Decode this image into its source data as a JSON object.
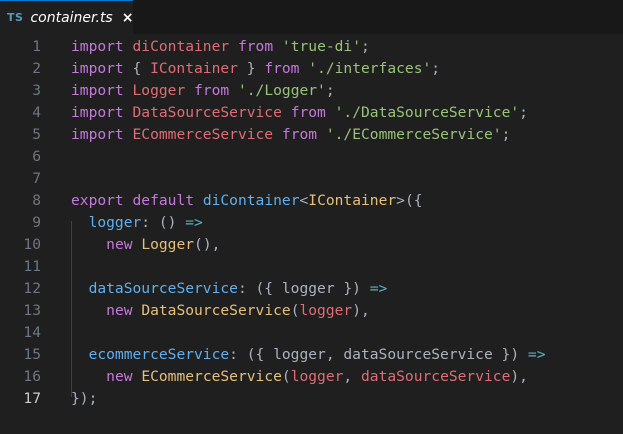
{
  "tab": {
    "lang_badge": "TS",
    "filename": "container.ts",
    "close_glyph": "×",
    "close_icon": "close-icon"
  },
  "colors": {
    "keyword": "#c678dd",
    "identifier": "#e06c75",
    "function": "#61afef",
    "type": "#e5c07b",
    "string": "#98c379",
    "punctuation": "#abb2bf",
    "operator": "#56b6c2"
  },
  "editor": {
    "active_line": "17",
    "lines": [
      {
        "number": "1",
        "tokens": [
          [
            "k",
            "import"
          ],
          [
            "p",
            " "
          ],
          [
            "d",
            "diContainer"
          ],
          [
            "p",
            " "
          ],
          [
            "k",
            "from"
          ],
          [
            "p",
            " "
          ],
          [
            "s",
            "'true-di'"
          ],
          [
            "p",
            ";"
          ]
        ]
      },
      {
        "number": "2",
        "tokens": [
          [
            "k",
            "import"
          ],
          [
            "p",
            " { "
          ],
          [
            "d",
            "IContainer"
          ],
          [
            "p",
            " } "
          ],
          [
            "k",
            "from"
          ],
          [
            "p",
            " "
          ],
          [
            "s",
            "'./interfaces'"
          ],
          [
            "p",
            ";"
          ]
        ]
      },
      {
        "number": "3",
        "tokens": [
          [
            "k",
            "import"
          ],
          [
            "p",
            " "
          ],
          [
            "d",
            "Logger"
          ],
          [
            "p",
            " "
          ],
          [
            "k",
            "from"
          ],
          [
            "p",
            " "
          ],
          [
            "s",
            "'./Logger'"
          ],
          [
            "p",
            ";"
          ]
        ]
      },
      {
        "number": "4",
        "tokens": [
          [
            "k",
            "import"
          ],
          [
            "p",
            " "
          ],
          [
            "d",
            "DataSourceService"
          ],
          [
            "p",
            " "
          ],
          [
            "k",
            "from"
          ],
          [
            "p",
            " "
          ],
          [
            "s",
            "'./DataSourceService'"
          ],
          [
            "p",
            ";"
          ]
        ]
      },
      {
        "number": "5",
        "tokens": [
          [
            "k",
            "import"
          ],
          [
            "p",
            " "
          ],
          [
            "d",
            "ECommerceService"
          ],
          [
            "p",
            " "
          ],
          [
            "k",
            "from"
          ],
          [
            "p",
            " "
          ],
          [
            "s",
            "'./ECommerceService'"
          ],
          [
            "p",
            ";"
          ]
        ]
      },
      {
        "number": "6",
        "tokens": []
      },
      {
        "number": "7",
        "tokens": []
      },
      {
        "number": "8",
        "tokens": [
          [
            "k",
            "export"
          ],
          [
            "p",
            " "
          ],
          [
            "k",
            "default"
          ],
          [
            "p",
            " "
          ],
          [
            "f",
            "diContainer"
          ],
          [
            "p",
            "<"
          ],
          [
            "t",
            "IContainer"
          ],
          [
            "p",
            ">({"
          ]
        ]
      },
      {
        "number": "9",
        "tokens": [
          [
            "p",
            "  "
          ],
          [
            "f",
            "logger"
          ],
          [
            "p",
            ": () "
          ],
          [
            "o",
            "=>"
          ]
        ]
      },
      {
        "number": "10",
        "tokens": [
          [
            "p",
            "    "
          ],
          [
            "k",
            "new"
          ],
          [
            "p",
            " "
          ],
          [
            "t",
            "Logger"
          ],
          [
            "p",
            "(),"
          ]
        ]
      },
      {
        "number": "11",
        "tokens": []
      },
      {
        "number": "12",
        "tokens": [
          [
            "p",
            "  "
          ],
          [
            "f",
            "dataSourceService"
          ],
          [
            "p",
            ": ({ logger }) "
          ],
          [
            "o",
            "=>"
          ]
        ]
      },
      {
        "number": "13",
        "tokens": [
          [
            "p",
            "    "
          ],
          [
            "k",
            "new"
          ],
          [
            "p",
            " "
          ],
          [
            "t",
            "DataSourceService"
          ],
          [
            "p",
            "("
          ],
          [
            "d",
            "logger"
          ],
          [
            "p",
            "),"
          ]
        ]
      },
      {
        "number": "14",
        "tokens": []
      },
      {
        "number": "15",
        "tokens": [
          [
            "p",
            "  "
          ],
          [
            "f",
            "ecommerceService"
          ],
          [
            "p",
            ": ({ logger, dataSourceService }) "
          ],
          [
            "o",
            "=>"
          ]
        ]
      },
      {
        "number": "16",
        "tokens": [
          [
            "p",
            "    "
          ],
          [
            "k",
            "new"
          ],
          [
            "p",
            " "
          ],
          [
            "t",
            "ECommerceService"
          ],
          [
            "p",
            "("
          ],
          [
            "d",
            "logger"
          ],
          [
            "p",
            ", "
          ],
          [
            "d",
            "dataSourceService"
          ],
          [
            "p",
            "),"
          ]
        ]
      },
      {
        "number": "17",
        "tokens": [
          [
            "p",
            "});"
          ]
        ]
      }
    ]
  }
}
